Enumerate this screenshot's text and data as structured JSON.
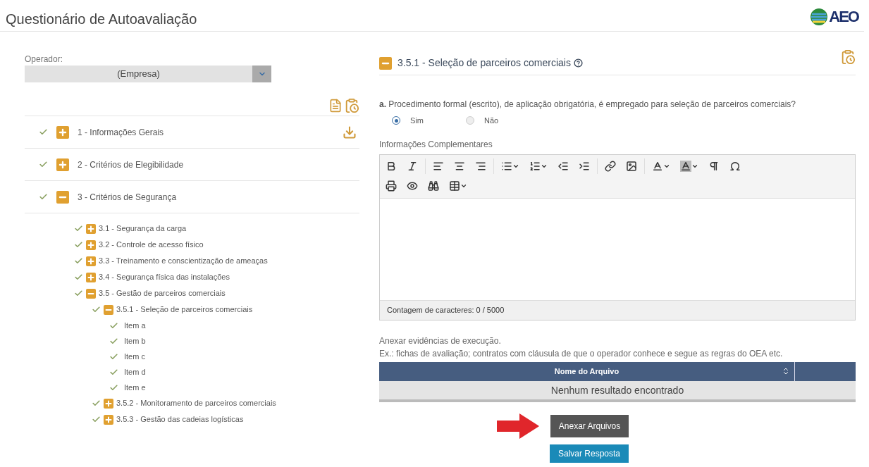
{
  "header": {
    "title": "Questionário de Autoavaliação",
    "logo_text": "AEO"
  },
  "operator": {
    "label": "Operador:",
    "value": "(Empresa)"
  },
  "tree": [
    {
      "kind": "section",
      "label": "1 - Informações Gerais",
      "completed": true,
      "expanded": false
    },
    {
      "kind": "section",
      "label": "2 - Critérios de Elegibilidade",
      "completed": true,
      "expanded": false
    },
    {
      "kind": "section",
      "label": "3 - Critérios de Segurança",
      "completed": true,
      "expanded": true,
      "children": [
        {
          "kind": "section",
          "label": "3.1 - Segurança da carga",
          "completed": true,
          "expanded": false
        },
        {
          "kind": "section",
          "label": "3.2 - Controle de acesso físico",
          "completed": true,
          "expanded": false
        },
        {
          "kind": "section",
          "label": "3.3 - Treinamento e conscientização de ameaças",
          "completed": true,
          "expanded": false
        },
        {
          "kind": "section",
          "label": "3.4 - Segurança física das instalações",
          "completed": true,
          "expanded": false
        },
        {
          "kind": "section",
          "label": "3.5 - Gestão de parceiros comerciais",
          "completed": true,
          "expanded": true,
          "children": [
            {
              "kind": "section",
              "label": "3.5.1 - Seleção de parceiros comerciais",
              "completed": true,
              "expanded": true,
              "children": [
                {
                  "kind": "item",
                  "label": "Item a",
                  "completed": true
                },
                {
                  "kind": "item",
                  "label": "Item b",
                  "completed": true
                },
                {
                  "kind": "item",
                  "label": "Item c",
                  "completed": true
                },
                {
                  "kind": "item",
                  "label": "Item d",
                  "completed": true
                },
                {
                  "kind": "item",
                  "label": "Item e",
                  "completed": true
                }
              ]
            },
            {
              "kind": "section",
              "label": "3.5.2 - Monitoramento de parceiros comerciais",
              "completed": true,
              "expanded": false
            },
            {
              "kind": "section",
              "label": "3.5.3 - Gestão das cadeias logísticas",
              "completed": true,
              "expanded": false
            }
          ]
        }
      ]
    }
  ],
  "detail": {
    "title": "3.5.1 - Seleção de parceiros comerciais",
    "expanded": true,
    "question": "**a.** Procedimento formal (escrito), de aplicação obrigatória, é empregado para seleção de parceiros comerciais?",
    "options": [
      {
        "label": "Sim",
        "selected": true
      },
      {
        "label": "Não",
        "selected": false
      }
    ],
    "editor_label": "Informações Complementares",
    "char_count": "Contagem de caracteres: 0 / 5000",
    "attach_hint": "Anexar evidências de execução.",
    "attach_example": "Ex.: fichas de avaliação; contratos com cláusula de que o operador conhece e segue as regras do OEA etc.",
    "table": {
      "columns": [
        "Nome do Arquivo"
      ],
      "empty": "Nenhum resultado encontrado"
    },
    "buttons": [
      {
        "kind": "attach",
        "label": "Anexar Arquivos"
      },
      {
        "kind": "save",
        "label": "Salvar Resposta"
      }
    ]
  }
}
